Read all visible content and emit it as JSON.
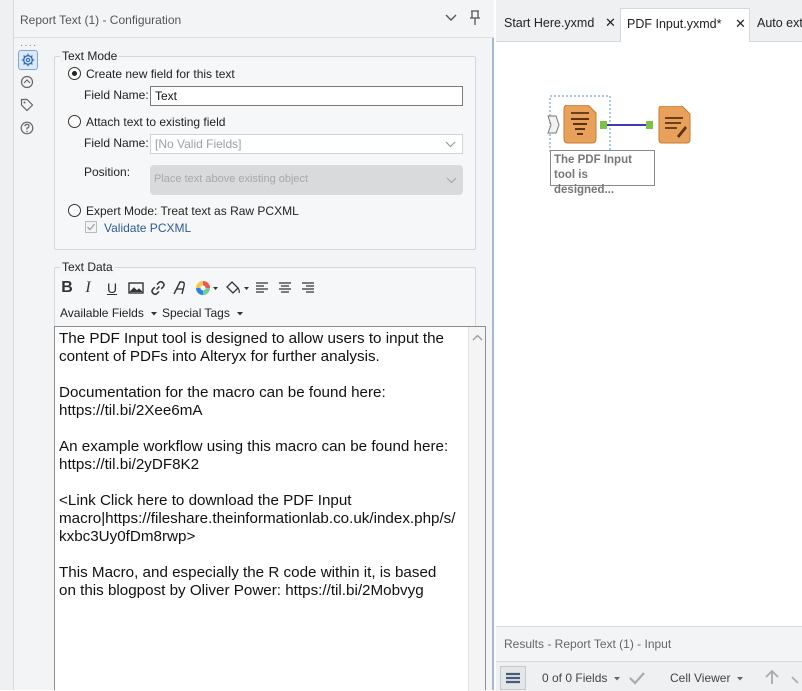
{
  "config": {
    "title": "Report Text (1) - Configuration",
    "icons": [
      "chevron-down-icon",
      "pin-icon"
    ],
    "side_icons": [
      "configuration-gear-icon",
      "connection-icon",
      "annotation-tag-icon",
      "help-icon"
    ]
  },
  "text_mode": {
    "group_label": "Text Mode",
    "option_create": "Create new field for this text",
    "field_name_label": "Field Name:",
    "field_name_value": "Text",
    "option_attach": "Attach text to existing field",
    "attach_field_label": "Field Name:",
    "attach_field_value": "[No Valid Fields]",
    "position_label": "Position:",
    "position_value": "Place text above existing object",
    "option_expert": "Expert Mode: Treat text as Raw PCXML",
    "validate_label": "Validate PCXML",
    "selected": "create"
  },
  "text_data": {
    "group_label": "Text Data",
    "toolbar_icons": [
      "bold-icon",
      "italic-icon",
      "underline-icon",
      "image-icon",
      "link-icon",
      "font-icon",
      "color-wheel-icon",
      "fill-bucket-icon",
      "align-left-icon",
      "align-center-icon",
      "align-right-icon"
    ],
    "available_fields": "Available Fields",
    "special_tags": "Special Tags",
    "paragraphs": [
      "The PDF Input tool is designed to allow users to input the content of PDFs into Alteryx for further analysis.",
      "Documentation for the macro can be found here: https://til.bi/2Xee6mA",
      "An example workflow using this macro can be found here: https://til.bi/2yDF8K2",
      "<Link Click here to download the PDF Input macro|https://fileshare.theinformationlab.co.uk/index.php/s/kxbc3Uy0fDm8rwp>",
      "This Macro, and especially the R code within it, is based on this blogpost by Oliver Power: https://til.bi/2Mobvyg"
    ]
  },
  "tabs": [
    {
      "label": "Start Here.yxmd",
      "active": false
    },
    {
      "label": "PDF Input.yxmd*",
      "active": true
    },
    {
      "label": "Auto ext",
      "active": false
    }
  ],
  "canvas": {
    "tool_annotation": "The PDF Input tool is designed..."
  },
  "results": {
    "title": "Results - Report Text (1) - Input",
    "fields": "0 of 0 Fields",
    "viewer": "Cell Viewer"
  },
  "colors": {
    "accent_blue": "#2f6fbd",
    "tool_orange": "#e8a15a",
    "connector_green": "#7cc243",
    "connector_line": "#3b3bb5"
  }
}
